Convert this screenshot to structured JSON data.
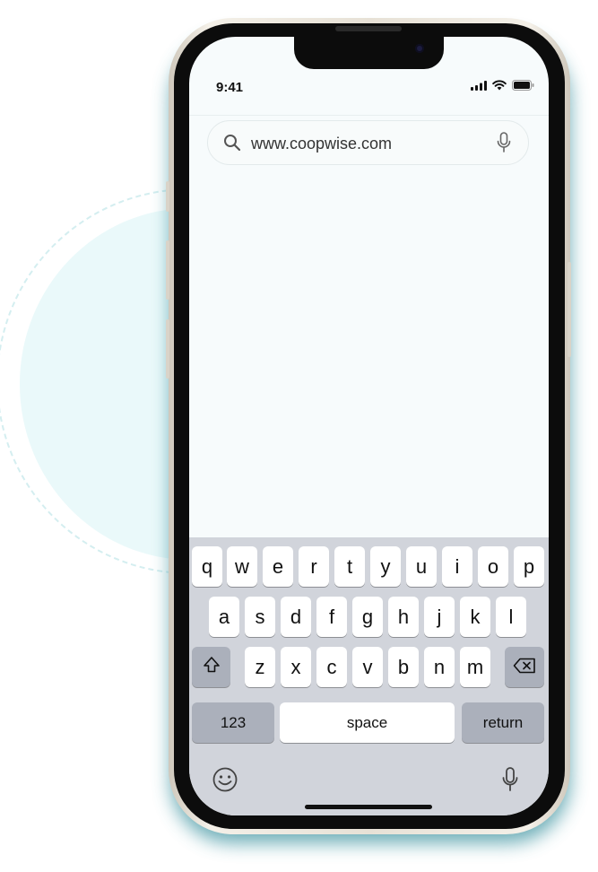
{
  "status_bar": {
    "time": "9:41",
    "icons": [
      "signal-icon",
      "wifi-icon",
      "battery-icon"
    ]
  },
  "address_bar": {
    "url": "www.coopwise.com",
    "left_icon": "search-icon",
    "right_icon": "microphone-icon"
  },
  "keyboard": {
    "row1": [
      "q",
      "w",
      "e",
      "r",
      "t",
      "y",
      "u",
      "i",
      "o",
      "p"
    ],
    "row2": [
      "a",
      "s",
      "d",
      "f",
      "g",
      "h",
      "j",
      "k",
      "l"
    ],
    "row3": [
      "z",
      "x",
      "c",
      "v",
      "b",
      "n",
      "m"
    ],
    "shift_icon": "shift-icon",
    "delete_icon": "backspace-icon",
    "numbers_label": "123",
    "space_label": "space",
    "return_label": "return",
    "emoji_icon": "emoji-icon",
    "dictation_icon": "microphone-icon"
  },
  "colors": {
    "accent": "#3d93a0",
    "keyboard_bg": "#d1d4db",
    "key_bg": "#ffffff",
    "function_key_bg": "#abb0bb",
    "screen_bg": "#f7fbfc"
  }
}
